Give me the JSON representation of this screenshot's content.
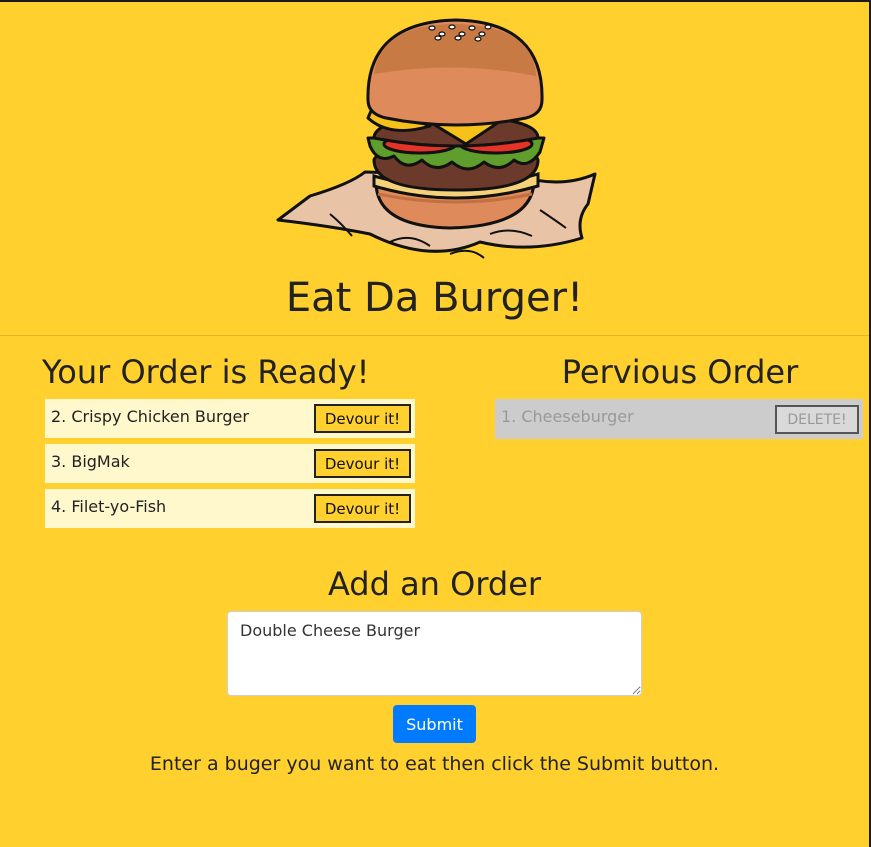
{
  "header": {
    "title": "Eat Da Burger!",
    "logo_icon": "burger-icon"
  },
  "ready": {
    "title": "Your Order is Ready!",
    "items": [
      {
        "label": "2. Crispy Chicken Burger",
        "button": "Devour it!"
      },
      {
        "label": "3. BigMak",
        "button": "Devour it!"
      },
      {
        "label": "4. Filet-yo-Fish",
        "button": "Devour it!"
      }
    ]
  },
  "previous": {
    "title": "Pervious Order",
    "items": [
      {
        "label": "1. Cheeseburger",
        "button": "DELETE!"
      }
    ]
  },
  "add": {
    "title": "Add an Order",
    "input_value": "Double Cheese Burger",
    "submit_label": "Submit",
    "hint": "Enter a buger you want to eat then click the Submit button."
  },
  "colors": {
    "background": "#ffd02e",
    "ready_item_bg": "#fff8cc",
    "previous_item_bg": "#cccccc",
    "submit_bg": "#007bff"
  }
}
